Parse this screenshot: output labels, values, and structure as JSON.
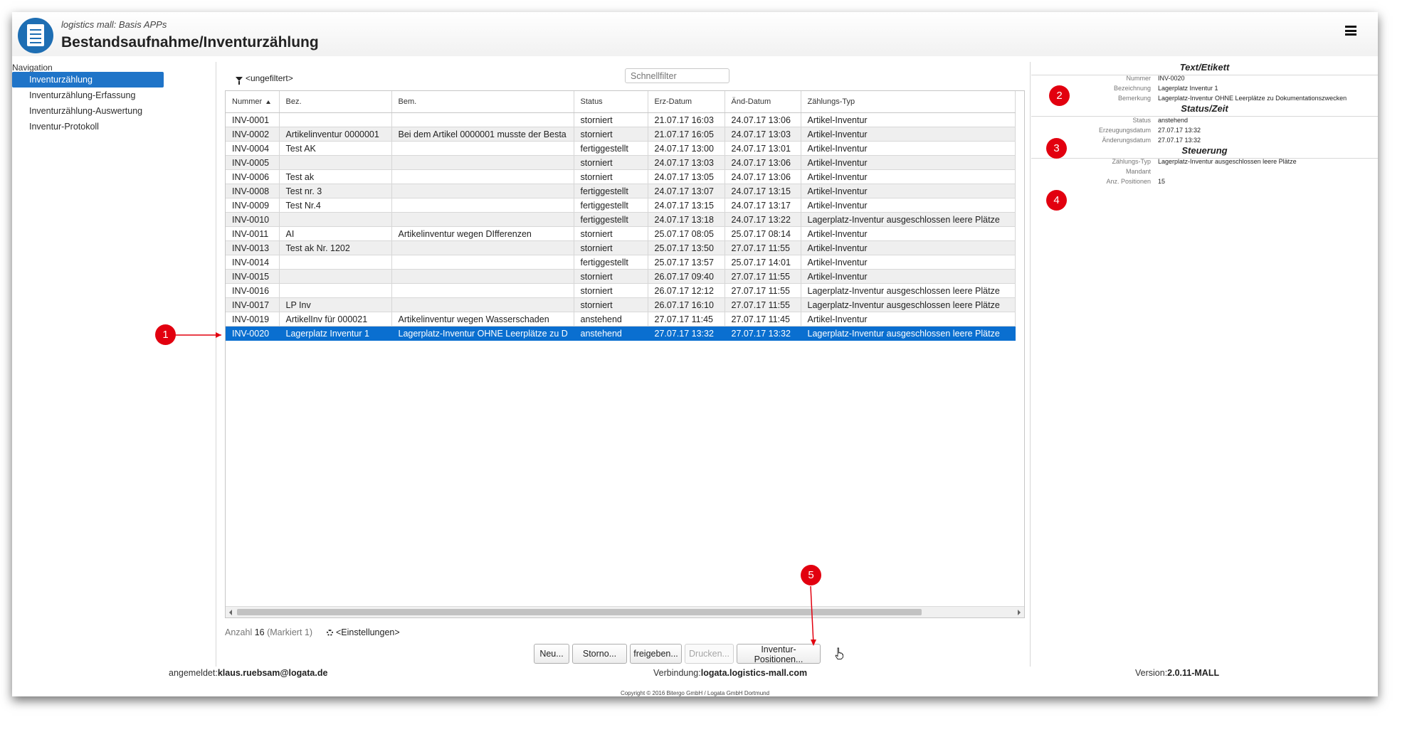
{
  "header": {
    "subtitle": "logistics mall: Basis APPs",
    "title": "Bestandsaufnahme/Inventurzählung"
  },
  "nav": {
    "label": "Navigation",
    "items": [
      {
        "label": "Inventurzählung",
        "active": true
      },
      {
        "label": "Inventurzählung-Erfassung",
        "active": false
      },
      {
        "label": "Inventurzählung-Auswertung",
        "active": false
      },
      {
        "label": "Inventur-Protokoll",
        "active": false
      }
    ]
  },
  "filter": {
    "state": "<ungefiltert>",
    "quickfilter_placeholder": "Schnellfilter"
  },
  "table": {
    "columns": [
      "Nummer",
      "Bez.",
      "Bem.",
      "Status",
      "Erz-Datum",
      "Änd-Datum",
      "Zählungs-Typ"
    ],
    "sorted_column": "Nummer",
    "rows": [
      [
        "INV-0001",
        "",
        "",
        "storniert",
        "21.07.17 16:03",
        "24.07.17 13:06",
        "Artikel-Inventur"
      ],
      [
        "INV-0002",
        "Artikelinventur 0000001",
        "Bei dem Artikel 0000001 musste der Besta",
        "storniert",
        "21.07.17 16:05",
        "24.07.17 13:03",
        "Artikel-Inventur"
      ],
      [
        "INV-0004",
        "Test AK",
        "",
        "fertiggestellt",
        "24.07.17 13:00",
        "24.07.17 13:01",
        "Artikel-Inventur"
      ],
      [
        "INV-0005",
        "",
        "",
        "storniert",
        "24.07.17 13:03",
        "24.07.17 13:06",
        "Artikel-Inventur"
      ],
      [
        "INV-0006",
        "Test ak",
        "",
        "storniert",
        "24.07.17 13:05",
        "24.07.17 13:06",
        "Artikel-Inventur"
      ],
      [
        "INV-0008",
        "Test nr. 3",
        "",
        "fertiggestellt",
        "24.07.17 13:07",
        "24.07.17 13:15",
        "Artikel-Inventur"
      ],
      [
        "INV-0009",
        "Test Nr.4",
        "",
        "fertiggestellt",
        "24.07.17 13:15",
        "24.07.17 13:17",
        "Artikel-Inventur"
      ],
      [
        "INV-0010",
        "",
        "",
        "fertiggestellt",
        "24.07.17 13:18",
        "24.07.17 13:22",
        "Lagerplatz-Inventur ausgeschlossen leere Plätze"
      ],
      [
        "INV-0011",
        "AI",
        "Artikelinventur wegen DIfferenzen",
        "storniert",
        "25.07.17 08:05",
        "25.07.17 08:14",
        "Artikel-Inventur"
      ],
      [
        "INV-0013",
        "Test ak Nr. 1202",
        "",
        "storniert",
        "25.07.17 13:50",
        "27.07.17 11:55",
        "Artikel-Inventur"
      ],
      [
        "INV-0014",
        "",
        "",
        "fertiggestellt",
        "25.07.17 13:57",
        "25.07.17 14:01",
        "Artikel-Inventur"
      ],
      [
        "INV-0015",
        "",
        "",
        "storniert",
        "26.07.17 09:40",
        "27.07.17 11:55",
        "Artikel-Inventur"
      ],
      [
        "INV-0016",
        "",
        "",
        "storniert",
        "26.07.17 12:12",
        "27.07.17 11:55",
        "Lagerplatz-Inventur ausgeschlossen leere Plätze"
      ],
      [
        "INV-0017",
        "LP Inv",
        "",
        "storniert",
        "26.07.17 16:10",
        "27.07.17 11:55",
        "Lagerplatz-Inventur ausgeschlossen leere Plätze"
      ],
      [
        "INV-0019",
        "ArtikelInv für 000021",
        "Artikelinventur wegen Wasserschaden",
        "anstehend",
        "27.07.17 11:45",
        "27.07.17 11:45",
        "Artikel-Inventur"
      ],
      [
        "INV-0020",
        "Lagerplatz Inventur 1",
        "Lagerplatz-Inventur OHNE Leerplätze zu D",
        "anstehend",
        "27.07.17 13:32",
        "27.07.17 13:32",
        "Lagerplatz-Inventur ausgeschlossen leere Plätze"
      ]
    ],
    "selected_index": 15
  },
  "status_bar": {
    "count_label": "Anzahl",
    "count": "16",
    "marked": "(Markiert 1)",
    "settings": "<Einstellungen>"
  },
  "buttons": {
    "new": "Neu...",
    "cancel": "Storno...",
    "release": "freigeben...",
    "print": "Drucken...",
    "positions": "Inventur-Positionen..."
  },
  "detail": {
    "text_section": {
      "title": "Text/Etikett",
      "fields": [
        {
          "label": "Nummer",
          "value": "INV-0020"
        },
        {
          "label": "Bezeichnung",
          "value": "Lagerplatz Inventur 1"
        },
        {
          "label": "Bemerkung",
          "value": "Lagerplatz-Inventur OHNE Leerplätze zu Dokumentationszwecken"
        }
      ]
    },
    "status_section": {
      "title": "Status/Zeit",
      "fields": [
        {
          "label": "Status",
          "value": "anstehend"
        },
        {
          "label": "Erzeugungsdatum",
          "value": "27.07.17 13:32"
        },
        {
          "label": "Änderungsdatum",
          "value": "27.07.17 13:32"
        }
      ]
    },
    "control_section": {
      "title": "Steuerung",
      "fields": [
        {
          "label": "Zählungs-Typ",
          "value": "Lagerplatz-Inventur ausgeschlossen leere Plätze"
        },
        {
          "label": "Mandant",
          "value": ""
        },
        {
          "label": "Anz. Positionen",
          "value": "15"
        }
      ]
    }
  },
  "footer": {
    "login_label": "angemeldet:",
    "login_user": "klaus.ruebsam@logata.de",
    "connection_label": "Verbindung:",
    "connection_host": "logata.logistics-mall.com",
    "version_label": "Version:",
    "version": "2.0.11-MALL",
    "copyright": "Copyright © 2016 Bitergo GmbH / Logata GmbH Dortmund"
  },
  "annotations": [
    "1",
    "2",
    "3",
    "4",
    "5"
  ],
  "colors": {
    "selection": "#0a6fd0",
    "nav_active": "#1f74c8",
    "badge": "#e2000f",
    "logo": "#1e6eb3"
  }
}
